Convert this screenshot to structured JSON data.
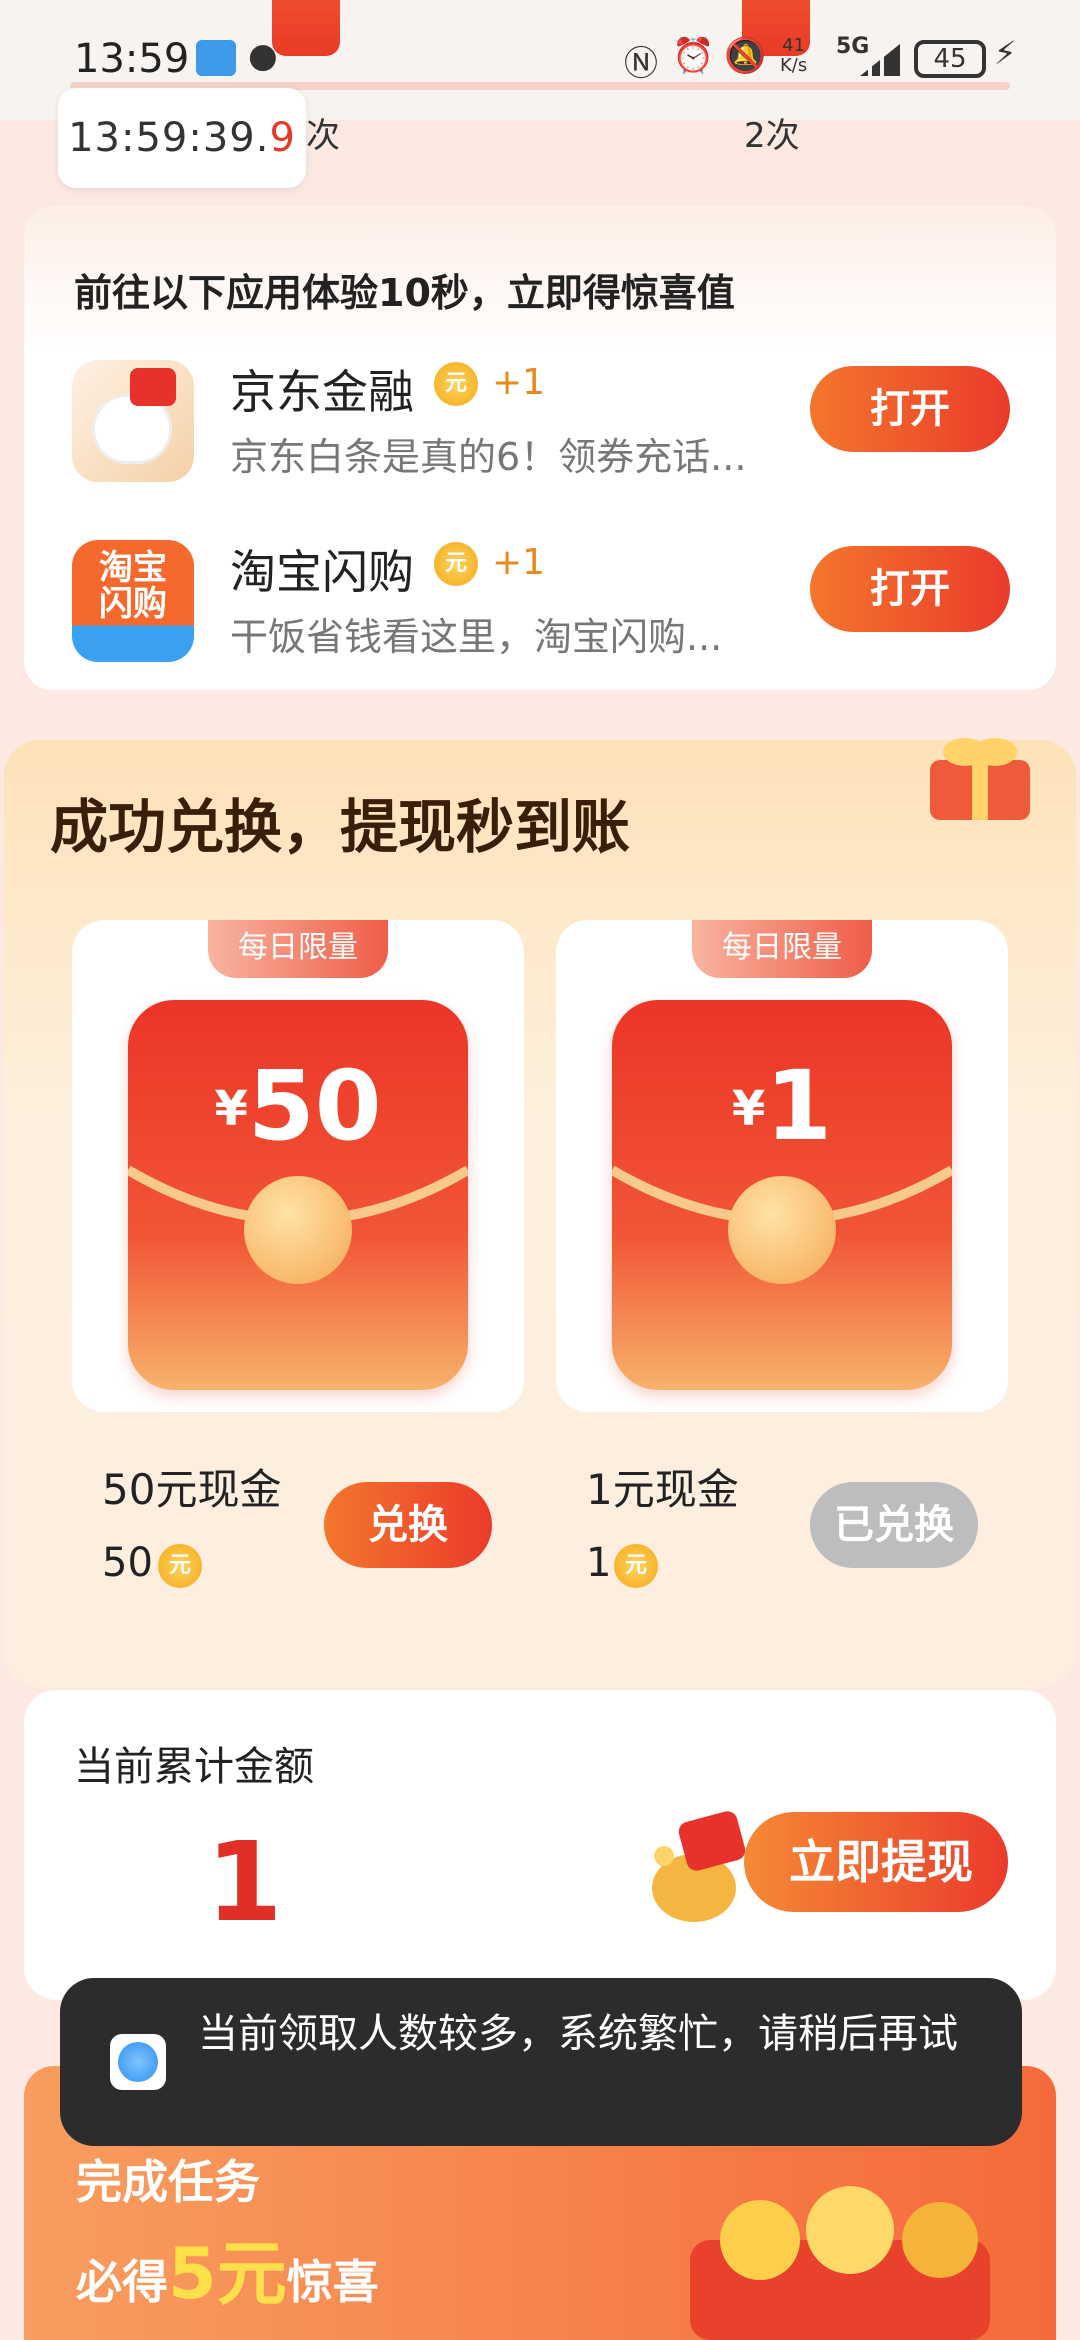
{
  "status_bar": {
    "time": "13:59",
    "net_speed": "41\nK/s",
    "signal": "5G",
    "battery": "45"
  },
  "timer": {
    "main": "13:59:39.",
    "tenths": "9"
  },
  "counters": [
    "次",
    "2次"
  ],
  "task": {
    "title": "前往以下应用体验10秒，立即得惊喜值",
    "apps": [
      {
        "name": "京东金融",
        "coin": "元",
        "bonus": "+1",
        "desc": "京东白条是真的6！领券充话...",
        "button": "打开"
      },
      {
        "name": "淘宝闪购",
        "icon_text": "淘宝\n闪购",
        "coin": "元",
        "bonus": "+1",
        "desc": "干饭省钱看这里，淘宝闪购...",
        "button": "打开"
      }
    ]
  },
  "exchange": {
    "title": "成功兑换，提现秒到账",
    "rewards": [
      {
        "tag": "每日限量",
        "currency": "¥",
        "amount": "50",
        "name": "50元现金",
        "cost": "50",
        "coin": "元",
        "button": "兑换",
        "exchanged": false
      },
      {
        "tag": "每日限量",
        "currency": "¥",
        "amount": "1",
        "name": "1元现金",
        "cost": "1",
        "coin": "元",
        "button": "已兑换",
        "exchanged": true
      }
    ]
  },
  "total": {
    "label": "当前累计金额",
    "value": "1",
    "button": "立即提现"
  },
  "toast": {
    "text": "当前领取人数较多，系统繁忙，请稍后再试"
  },
  "banner": {
    "line1": "完成任务",
    "line2_pre": "必得",
    "line2_big": "5元",
    "line2_post": "惊喜"
  },
  "colors": {
    "accent": "#ea3b2b",
    "gold": "#f2a91a",
    "disabled": "#bdbdbd"
  }
}
